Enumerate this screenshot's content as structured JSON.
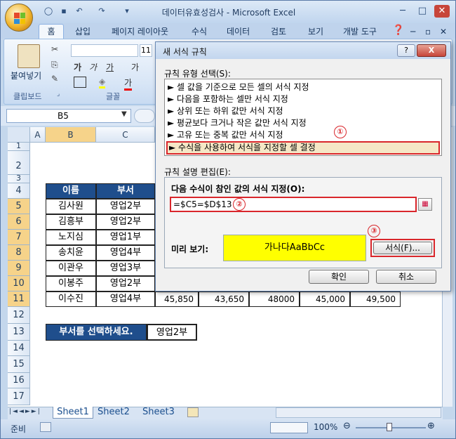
{
  "window": {
    "title": "데이터유효성검사 - Microsoft Excel"
  },
  "ribbon": {
    "tabs": [
      "홈",
      "삽입",
      "페이지 레이아웃",
      "수식",
      "데이터",
      "검토",
      "보기",
      "개발 도구"
    ],
    "font_size": "11",
    "paste_label": "붙여넣기",
    "groups": {
      "clipboard": "클립보드",
      "font": "글꼴"
    }
  },
  "formula_bar": {
    "name_box": "B5"
  },
  "sheet": {
    "columns": [
      "A",
      "B",
      "C"
    ],
    "rows": [
      "1",
      "2",
      "3",
      "4",
      "5",
      "6",
      "7",
      "8",
      "9",
      "10",
      "11",
      "12",
      "13",
      "14",
      "15",
      "16",
      "17"
    ],
    "header_name": "이름",
    "header_dept": "부서",
    "records": [
      {
        "name": "김사원",
        "dept": "영업2부"
      },
      {
        "name": "김흥부",
        "dept": "영업2부"
      },
      {
        "name": "노지심",
        "dept": "영업1부"
      },
      {
        "name": "송치윤",
        "dept": "영업4부"
      },
      {
        "name": "이관우",
        "dept": "영업3부"
      },
      {
        "name": "이봉주",
        "dept": "영업2부"
      },
      {
        "name": "이수진",
        "dept": "영업4부"
      }
    ],
    "row11_values": [
      "45,850",
      "43,650",
      "48000",
      "45,000",
      "49,500"
    ],
    "select_label": "부서를 선택하세요.",
    "select_value": "영업2부"
  },
  "sheet_tabs": [
    "Sheet1",
    "Sheet2",
    "Sheet3"
  ],
  "status": {
    "ready": "준비",
    "zoom": "100%"
  },
  "dialog": {
    "title": "새 서식 규칙",
    "rule_type_label": "규칙 유형 선택(S):",
    "rule_types": [
      "► 셀 값을 기준으로 모든 셀의 서식 지정",
      "► 다음을 포함하는 셀만 서식 지정",
      "► 상위 또는 하위 값만 서식 지정",
      "► 평균보다 크거나 작은 값만 서식 지정",
      "► 고유 또는 중복 값만 서식 지정",
      "► 수식을 사용하여 서식을 지정할 셀 결정"
    ],
    "edit_label": "규칙 설명 편집(E):",
    "formula_label": "다음 수식이 참인 값의 서식 지정(O):",
    "formula_value": "=$C5=$D$13",
    "preview_label": "미리 보기:",
    "preview_text": "가나다AaBbCc",
    "format_button": "서식(F)...",
    "ok_button": "확인",
    "cancel_button": "취소",
    "help": "?",
    "close": "X",
    "callouts": [
      "①",
      "②",
      "③"
    ],
    "colors": {
      "preview_fill": "#ffff00",
      "highlight": "#d9262b"
    }
  }
}
